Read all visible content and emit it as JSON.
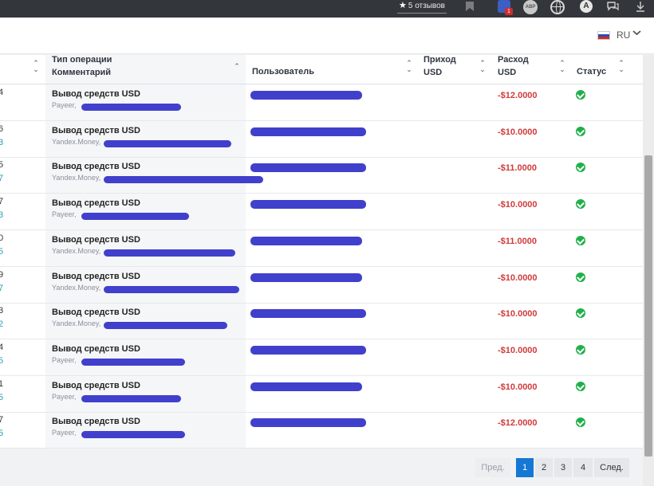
{
  "topbar": {
    "reviews_label": "5 отзывов",
    "star_icon": "★",
    "ext_badge": "1",
    "abp_label": "ABP",
    "a_label": "A"
  },
  "header": {
    "language": "RU",
    "chevron": "⌄"
  },
  "table": {
    "columns": {
      "type_line1": "Тип операции",
      "type_line2": "Комментарий",
      "user": "Пользователь",
      "income_line1": "Приход",
      "income_line2": "USD",
      "expense_line1": "Расход",
      "expense_line2": "USD",
      "status": "Статус"
    },
    "rows": [
      {
        "id_top": "4",
        "id_bottom": "",
        "operation": "Вывод средств USD",
        "method": "Payeer,",
        "expense": "-$12.0000"
      },
      {
        "id_top": "6",
        "id_bottom": "3",
        "operation": "Вывод средств USD",
        "method": "Yandex.Money,",
        "expense": "-$10.0000"
      },
      {
        "id_top": "5",
        "id_bottom": "7",
        "operation": "Вывод средств USD",
        "method": "Yandex.Money,",
        "expense": "-$11.0000"
      },
      {
        "id_top": "7",
        "id_bottom": "3",
        "operation": "Вывод средств USD",
        "method": "Payeer,",
        "expense": "-$10.0000"
      },
      {
        "id_top": "0",
        "id_bottom": "5",
        "operation": "Вывод средств USD",
        "method": "Yandex.Money,",
        "expense": "-$11.0000"
      },
      {
        "id_top": "9",
        "id_bottom": "7",
        "operation": "Вывод средств USD",
        "method": "Yandex.Money,",
        "expense": "-$10.0000"
      },
      {
        "id_top": "3",
        "id_bottom": "2",
        "operation": "Вывод средств USD",
        "method": "Yandex.Money,",
        "expense": "-$10.0000"
      },
      {
        "id_top": "4",
        "id_bottom": "5",
        "operation": "Вывод средств USD",
        "method": "Payeer,",
        "expense": "-$10.0000"
      },
      {
        "id_top": "1",
        "id_bottom": "5",
        "operation": "Вывод средств USD",
        "method": "Payeer,",
        "expense": "-$10.0000"
      },
      {
        "id_top": "7",
        "id_bottom": "5",
        "operation": "Вывод средств USD",
        "method": "Payeer,",
        "expense": "-$12.0000"
      }
    ]
  },
  "pagination": {
    "prev": "Пред.",
    "pages": [
      "1",
      "2",
      "3",
      "4"
    ],
    "next": "След.",
    "current": "1"
  },
  "colors": {
    "accent": "#1478d4",
    "expense": "#d03b3b",
    "status_ok": "#20b04b",
    "redaction": "#3030c8"
  }
}
